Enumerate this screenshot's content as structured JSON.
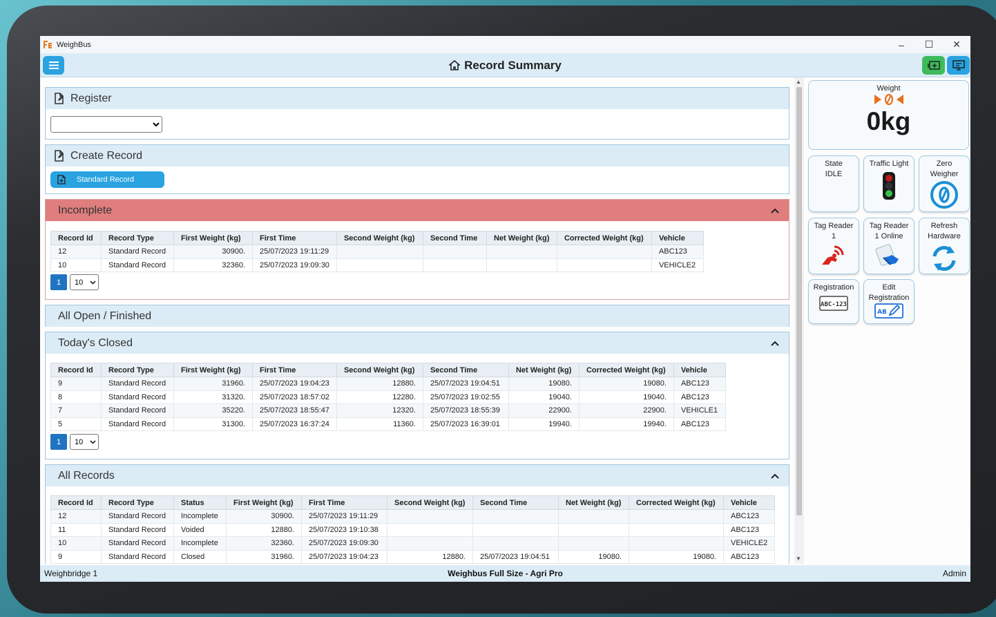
{
  "window": {
    "title": "WeighBus"
  },
  "header": {
    "title": "Record Summary"
  },
  "register": {
    "title": "Register",
    "selected": ""
  },
  "create_record": {
    "title": "Create Record",
    "button": "Standard Record"
  },
  "incomplete": {
    "title": "Incomplete",
    "columns": [
      "Record Id",
      "Record Type",
      "First Weight (kg)",
      "First Time",
      "Second Weight (kg)",
      "Second Time",
      "Net Weight (kg)",
      "Corrected Weight (kg)",
      "Vehicle"
    ],
    "rows": [
      [
        "12",
        "Standard Record",
        "30900.",
        "25/07/2023 19:11:29",
        "",
        "",
        "",
        "",
        "ABC123"
      ],
      [
        "10",
        "Standard Record",
        "32360.",
        "25/07/2023 19:09:30",
        "",
        "",
        "",
        "",
        "VEHICLE2"
      ]
    ],
    "page": "1",
    "page_size": "10"
  },
  "all_open": {
    "title": "All Open / Finished"
  },
  "todays_closed": {
    "title": "Today's Closed",
    "columns": [
      "Record Id",
      "Record Type",
      "First Weight (kg)",
      "First Time",
      "Second Weight (kg)",
      "Second Time",
      "Net Weight (kg)",
      "Corrected Weight (kg)",
      "Vehicle"
    ],
    "rows": [
      [
        "9",
        "Standard Record",
        "31960.",
        "25/07/2023 19:04:23",
        "12880.",
        "25/07/2023 19:04:51",
        "19080.",
        "19080.",
        "ABC123"
      ],
      [
        "8",
        "Standard Record",
        "31320.",
        "25/07/2023 18:57:02",
        "12280.",
        "25/07/2023 19:02:55",
        "19040.",
        "19040.",
        "ABC123"
      ],
      [
        "7",
        "Standard Record",
        "35220.",
        "25/07/2023 18:55:47",
        "12320.",
        "25/07/2023 18:55:39",
        "22900.",
        "22900.",
        "VEHICLE1"
      ],
      [
        "5",
        "Standard Record",
        "31300.",
        "25/07/2023 16:37:24",
        "11360.",
        "25/07/2023 16:39:01",
        "19940.",
        "19940.",
        "ABC123"
      ]
    ],
    "page": "1",
    "page_size": "10"
  },
  "all_records": {
    "title": "All Records",
    "columns": [
      "Record Id",
      "Record Type",
      "Status",
      "First Weight (kg)",
      "First Time",
      "Second Weight (kg)",
      "Second Time",
      "Net Weight (kg)",
      "Corrected Weight (kg)",
      "Vehicle"
    ],
    "rows": [
      [
        "12",
        "Standard Record",
        "Incomplete",
        "30900.",
        "25/07/2023 19:11:29",
        "",
        "",
        "",
        "",
        "ABC123"
      ],
      [
        "11",
        "Standard Record",
        "Voided",
        "12880.",
        "25/07/2023 19:10:38",
        "",
        "",
        "",
        "",
        "ABC123"
      ],
      [
        "10",
        "Standard Record",
        "Incomplete",
        "32360.",
        "25/07/2023 19:09:30",
        "",
        "",
        "",
        "",
        "VEHICLE2"
      ],
      [
        "9",
        "Standard Record",
        "Closed",
        "31960.",
        "25/07/2023 19:04:23",
        "12880.",
        "25/07/2023 19:04:51",
        "19080.",
        "19080.",
        "ABC123"
      ]
    ]
  },
  "side": {
    "weight_label": "Weight",
    "weight_value": "0kg",
    "tiles": {
      "state_label": "State",
      "state_value": "IDLE",
      "traffic_light": "Traffic Light",
      "zero_weigher_1": "Zero",
      "zero_weigher_2": "Weigher",
      "tag_reader_1a": "Tag Reader",
      "tag_reader_1b": "1",
      "tag_reader_online_1": "Tag Reader",
      "tag_reader_online_2": "1 Online",
      "refresh_1": "Refresh",
      "refresh_2": "Hardware",
      "registration": "Registration",
      "registration_plate": "ABC-123",
      "edit_reg_1": "Edit",
      "edit_reg_2": "Registration",
      "edit_reg_plate": "AB"
    }
  },
  "statusbar": {
    "left": "Weighbridge 1",
    "center": "Weighbus Full Size - Agri Pro",
    "right": "Admin"
  },
  "colors": {
    "accent": "#2aa3e0",
    "header_bg": "#dcecf6",
    "incomplete_header": "#e07e7e",
    "pager_active": "#1f74c2",
    "zero_icon": "#1b8fd6",
    "tag_icon": "#d9251c"
  },
  "icons": {
    "menu": "hamburger-icon",
    "home": "home-icon",
    "register": "document-edit-icon",
    "create_record": "document-edit-icon",
    "standard_record": "add-document-icon",
    "collapse": "chevron-up-icon",
    "zero_center": "zero-center-icon",
    "traffic_light": "traffic-light-icon",
    "zero_weigher": "zero-circle-icon",
    "tag_reader": "rfid-hand-icon",
    "tag_reader_online": "rfid-scan-icon",
    "refresh": "refresh-icon",
    "registration": "license-plate-icon",
    "edit_registration": "edit-plate-icon"
  }
}
